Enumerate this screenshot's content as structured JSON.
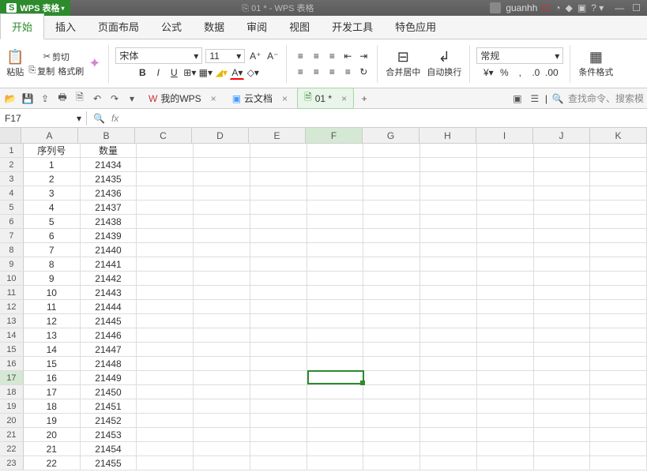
{
  "title": {
    "app": "WPS 表格",
    "doc": "01 * - WPS 表格"
  },
  "user": {
    "name": "guanhh"
  },
  "menu": {
    "tabs": [
      "开始",
      "插入",
      "页面布局",
      "公式",
      "数据",
      "审阅",
      "视图",
      "开发工具",
      "特色应用"
    ],
    "active": 0
  },
  "ribbon": {
    "paste": "粘贴",
    "cut": "剪切",
    "copy": "复制",
    "format_painter": "格式刷",
    "font_name": "宋体",
    "font_size": "11",
    "merge": "合并居中",
    "wrap": "自动换行",
    "number_format": "常规",
    "cond_format": "条件格式"
  },
  "doctabs": {
    "wps": "我的WPS",
    "cloud": "云文档",
    "doc": "01 *",
    "search": "查找命令、搜索模"
  },
  "namebox": "F17",
  "columns": [
    "A",
    "B",
    "C",
    "D",
    "E",
    "F",
    "G",
    "H",
    "I",
    "J",
    "K"
  ],
  "headers": {
    "A": "序列号",
    "B": "数量"
  },
  "rows": [
    {
      "n": 1,
      "A": "序列号",
      "B": "数量"
    },
    {
      "n": 2,
      "A": "1",
      "B": "21434"
    },
    {
      "n": 3,
      "A": "2",
      "B": "21435"
    },
    {
      "n": 4,
      "A": "3",
      "B": "21436"
    },
    {
      "n": 5,
      "A": "4",
      "B": "21437"
    },
    {
      "n": 6,
      "A": "5",
      "B": "21438"
    },
    {
      "n": 7,
      "A": "6",
      "B": "21439"
    },
    {
      "n": 8,
      "A": "7",
      "B": "21440"
    },
    {
      "n": 9,
      "A": "8",
      "B": "21441"
    },
    {
      "n": 10,
      "A": "9",
      "B": "21442"
    },
    {
      "n": 11,
      "A": "10",
      "B": "21443"
    },
    {
      "n": 12,
      "A": "11",
      "B": "21444"
    },
    {
      "n": 13,
      "A": "12",
      "B": "21445"
    },
    {
      "n": 14,
      "A": "13",
      "B": "21446"
    },
    {
      "n": 15,
      "A": "14",
      "B": "21447"
    },
    {
      "n": 16,
      "A": "15",
      "B": "21448"
    },
    {
      "n": 17,
      "A": "16",
      "B": "21449"
    },
    {
      "n": 18,
      "A": "17",
      "B": "21450"
    },
    {
      "n": 19,
      "A": "18",
      "B": "21451"
    },
    {
      "n": 20,
      "A": "19",
      "B": "21452"
    },
    {
      "n": 21,
      "A": "20",
      "B": "21453"
    },
    {
      "n": 22,
      "A": "21",
      "B": "21454"
    },
    {
      "n": 23,
      "A": "22",
      "B": "21455"
    }
  ],
  "selection": {
    "cell": "F17",
    "row": 17,
    "col": "F"
  }
}
